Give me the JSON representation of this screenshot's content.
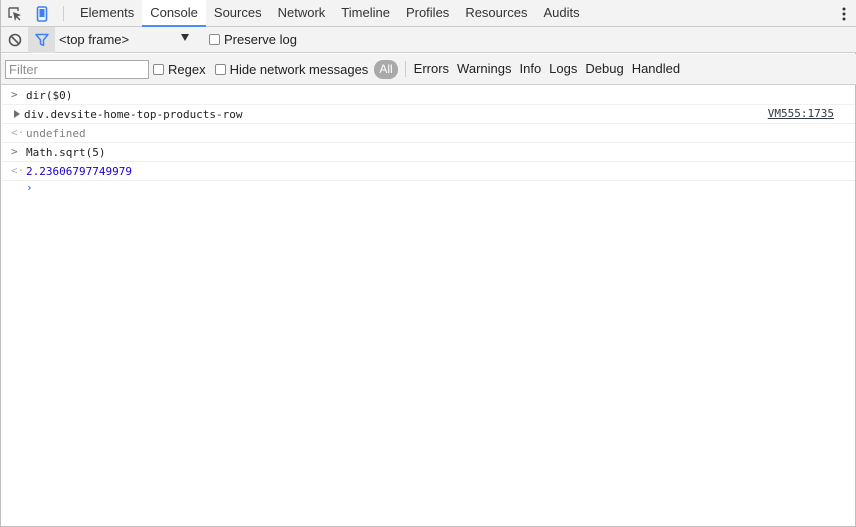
{
  "tabs": [
    {
      "label": "Elements",
      "selected": false
    },
    {
      "label": "Console",
      "selected": true
    },
    {
      "label": "Sources",
      "selected": false
    },
    {
      "label": "Network",
      "selected": false
    },
    {
      "label": "Timeline",
      "selected": false
    },
    {
      "label": "Profiles",
      "selected": false
    },
    {
      "label": "Resources",
      "selected": false
    },
    {
      "label": "Audits",
      "selected": false
    }
  ],
  "toolbar": {
    "frame_select_value": "<top frame>",
    "preserve_log_label": "Preserve log",
    "preserve_log_checked": false
  },
  "filterbar": {
    "filter_placeholder": "Filter",
    "regex_label": "Regex",
    "hide_network_label": "Hide network messages",
    "all_label": "All",
    "levels": [
      "Errors",
      "Warnings",
      "Info",
      "Logs",
      "Debug",
      "Handled"
    ]
  },
  "console": {
    "messages": [
      {
        "type": "input",
        "text": "dir($0)"
      },
      {
        "type": "object",
        "text": "div.devsite-home-top-products-row",
        "source": "VM555:1735"
      },
      {
        "type": "result-undefined",
        "text": "undefined"
      },
      {
        "type": "input",
        "text": "Math.sqrt(5)"
      },
      {
        "type": "result-number",
        "text": "2.23606797749979"
      }
    ],
    "prompt_text": ""
  },
  "colors": {
    "accent": "#4b8df8",
    "number": "#1c00cf",
    "prompt": "#367cf1"
  },
  "icons": {
    "inspect": "inspect-element-icon",
    "device": "device-mode-icon",
    "menu": "kebab-menu-icon",
    "clear": "clear-console-icon",
    "filter": "filter-icon"
  }
}
